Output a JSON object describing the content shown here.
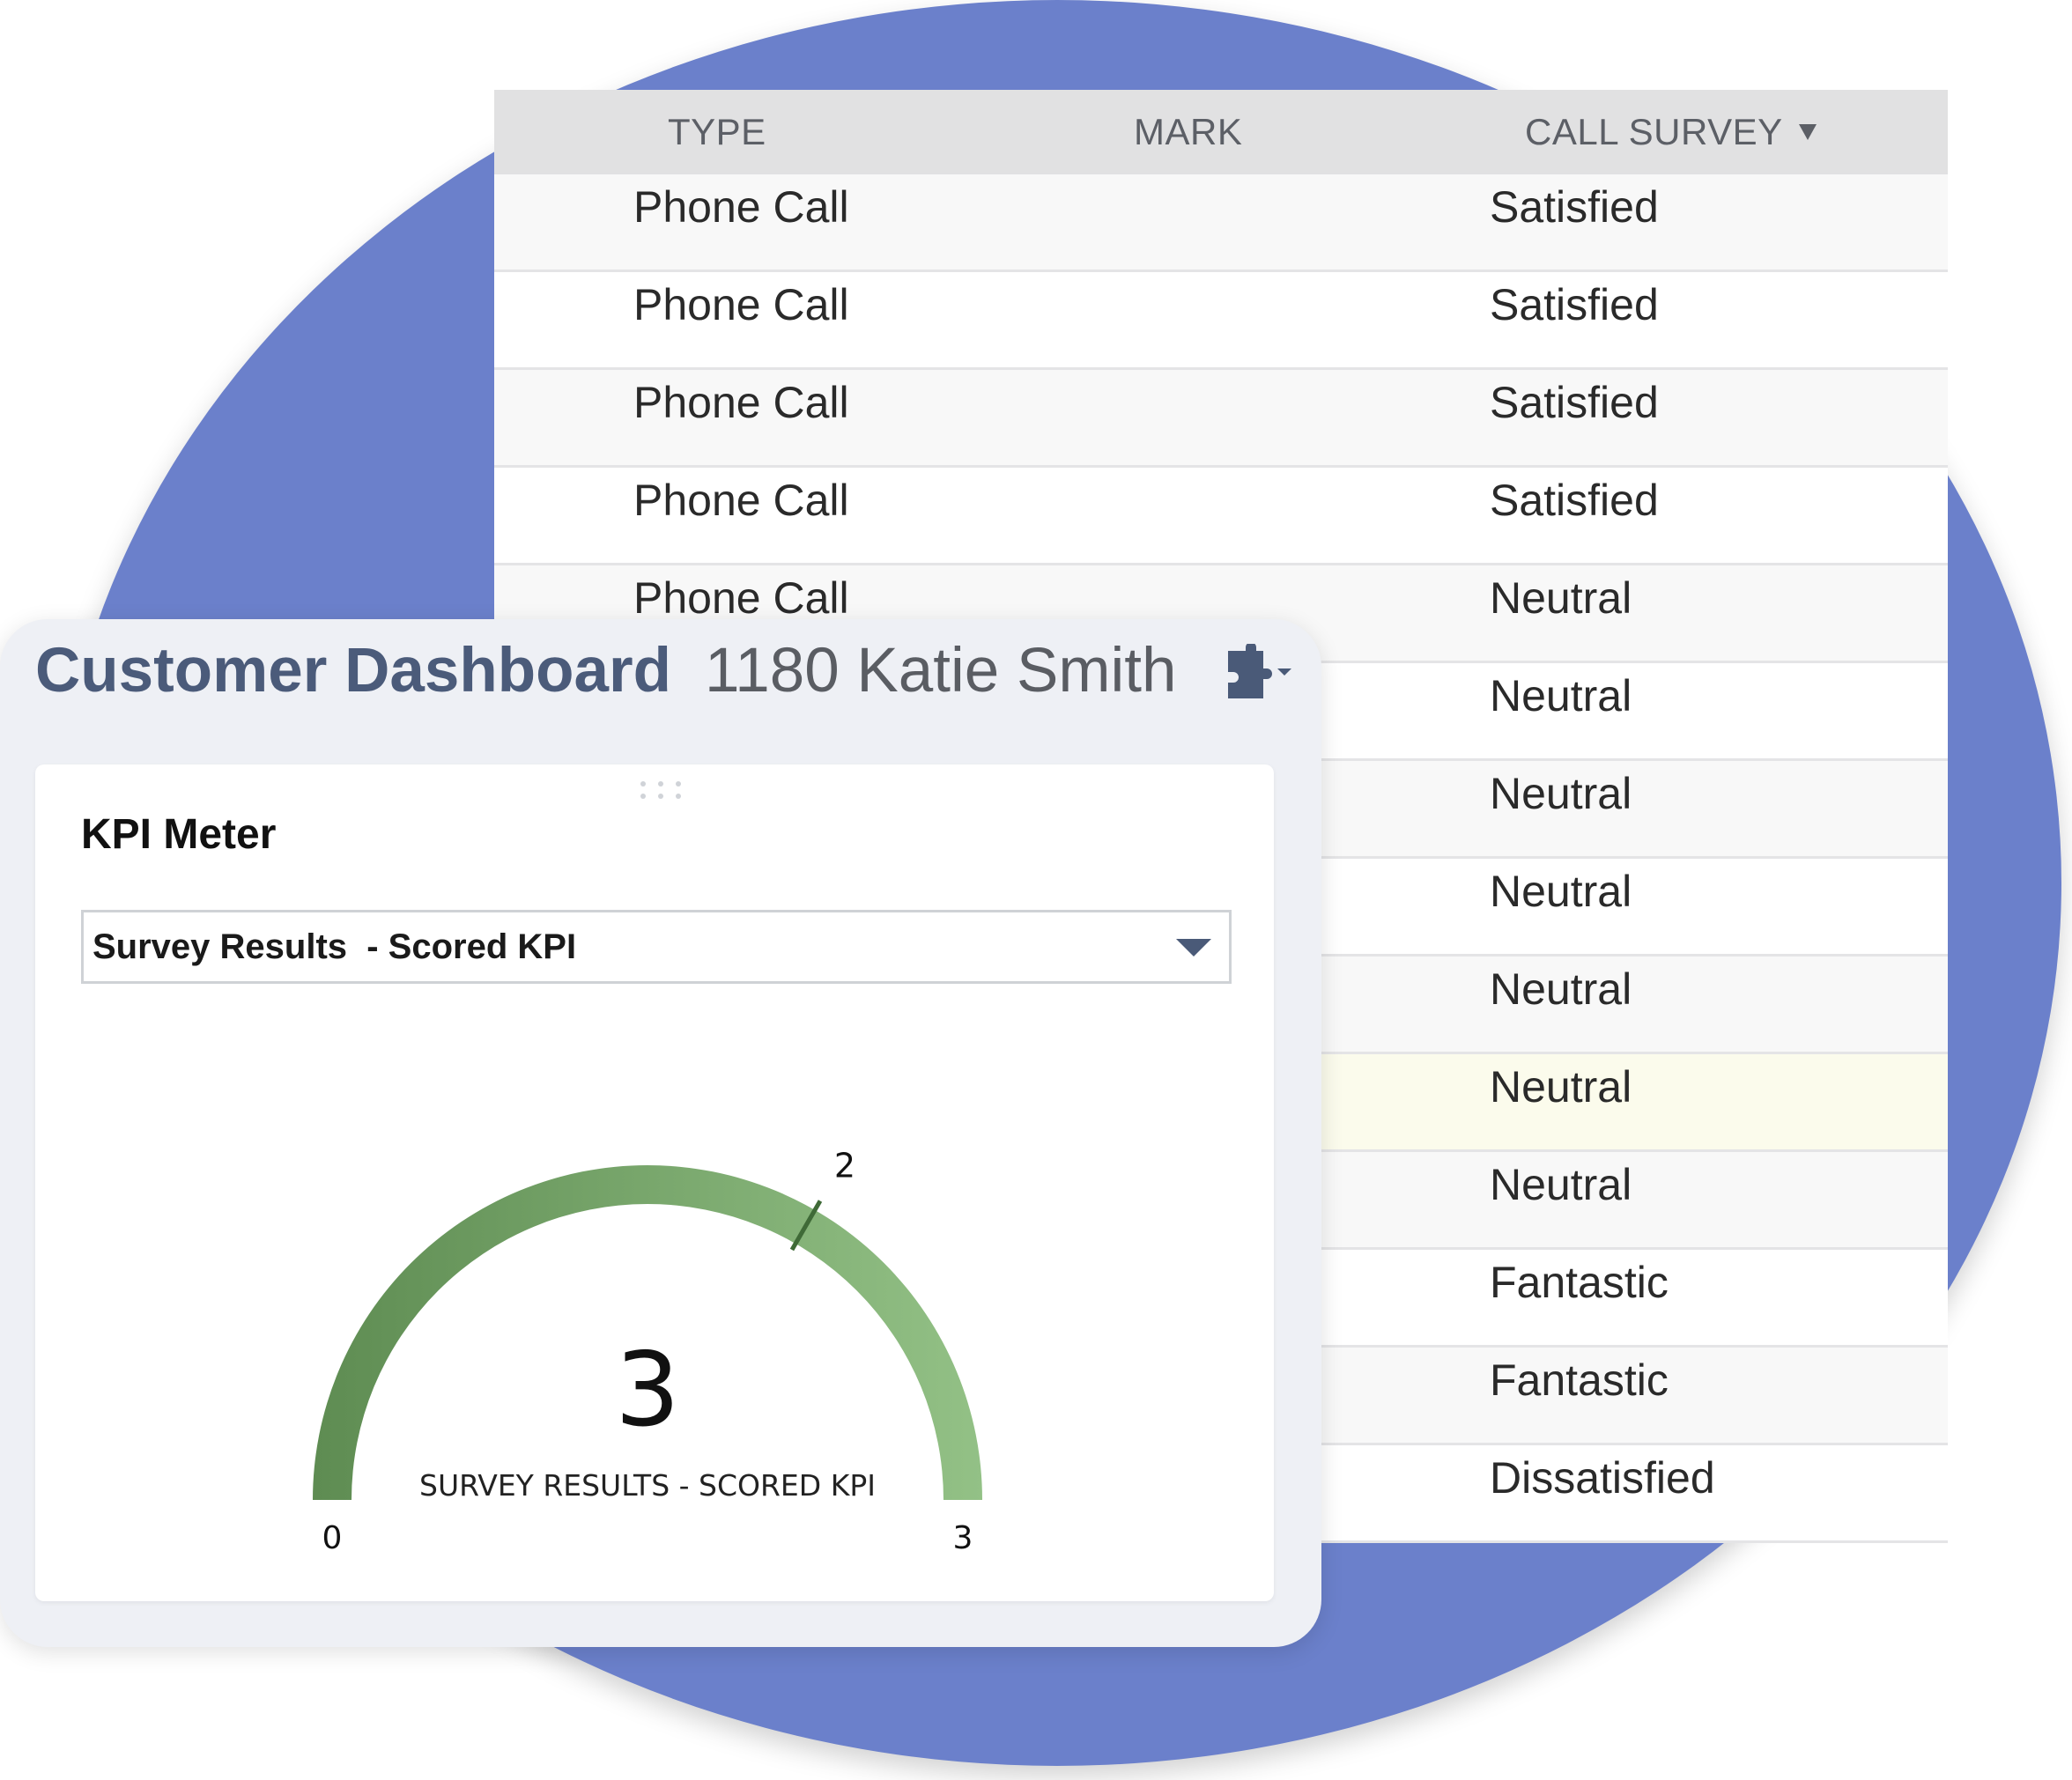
{
  "table": {
    "columns": [
      "TYPE",
      "MARK",
      "CALL SURVEY"
    ],
    "sort_icon": "triangle-down-icon",
    "rows": [
      {
        "type": "Phone Call",
        "mark": "",
        "call_survey": "Satisfied"
      },
      {
        "type": "Phone Call",
        "mark": "",
        "call_survey": "Satisfied"
      },
      {
        "type": "Phone Call",
        "mark": "",
        "call_survey": "Satisfied"
      },
      {
        "type": "Phone Call",
        "mark": "",
        "call_survey": "Satisfied"
      },
      {
        "type": "Phone Call",
        "mark": "",
        "call_survey": "Neutral"
      },
      {
        "type": "",
        "mark": "",
        "call_survey": "Neutral"
      },
      {
        "type": "",
        "mark": "",
        "call_survey": "Neutral"
      },
      {
        "type": "",
        "mark": "",
        "call_survey": "Neutral"
      },
      {
        "type": "",
        "mark": "",
        "call_survey": "Neutral"
      },
      {
        "type": "",
        "mark": "",
        "call_survey": "Neutral"
      },
      {
        "type": "",
        "mark": "",
        "call_survey": "Neutral"
      },
      {
        "type": "",
        "mark": "",
        "call_survey": "Fantastic"
      },
      {
        "type": "",
        "mark": "",
        "call_survey": "Fantastic"
      },
      {
        "type": "",
        "mark": "",
        "call_survey": "Dissatisfied"
      }
    ]
  },
  "dashboard": {
    "title": "Customer Dashboard",
    "subtitle": "1180 Katie Smith",
    "menu_icon": "puzzle-dropdown-icon",
    "card": {
      "title": "KPI Meter",
      "select_value": "Survey Results  - Scored KPI",
      "gauge": {
        "min": 0,
        "max": 3,
        "target": 2,
        "value": 3,
        "min_label": "0",
        "max_label": "3",
        "target_label": "2",
        "value_label": "3",
        "caption": "SURVEY RESULTS - SCORED KPI",
        "color_start": "#5e8c52",
        "color_end": "#93c186"
      }
    }
  },
  "colors": {
    "background_circle": "#6b80cb",
    "title_blue": "#4b5b7a",
    "highlight_row": "#fbfbec"
  }
}
